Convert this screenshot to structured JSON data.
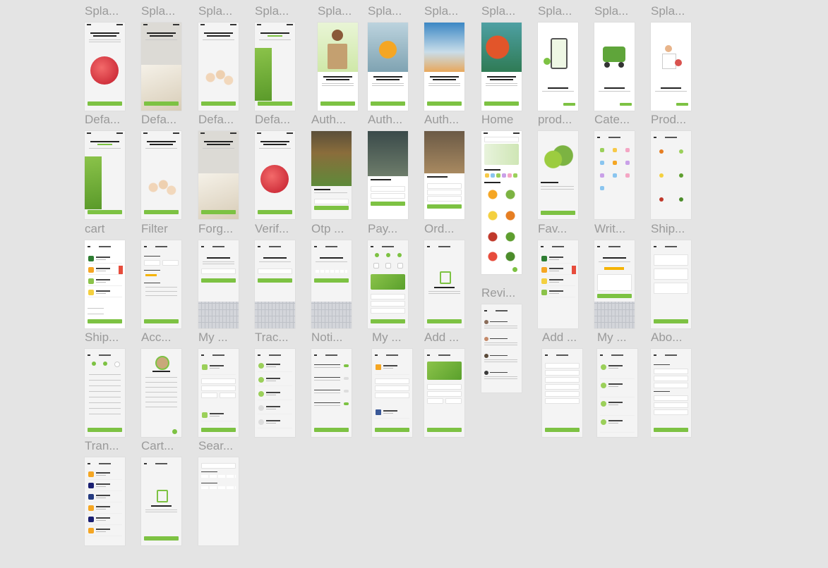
{
  "canvas": {
    "background": "#e4e4e4",
    "accent": "#7dc243"
  },
  "frames": {
    "f01": "Spla...",
    "f02": "Spla...",
    "f03": "Spla...",
    "f04": "Spla...",
    "f05": "Spla...",
    "f06": "Spla...",
    "f07": "Spla...",
    "f08": "Spla...",
    "f09": "Spla...",
    "f10": "Spla...",
    "f11": "Spla...",
    "f12": "Defa...",
    "f13": "Defa...",
    "f14": "Defa...",
    "f15": "Defa...",
    "f16": "Auth...",
    "f17": "Auth...",
    "f18": "Auth...",
    "f19": "Home",
    "f20": "prod...",
    "f21": "Cate...",
    "f22": "Prod...",
    "f23": "cart",
    "f24": "Filter",
    "f25": "Forg...",
    "f26": "Verif...",
    "f27": "Otp ...",
    "f28": "Pay...",
    "f29": "Ord...",
    "f30": "Revi...",
    "f31": "Fav...",
    "f32": "Writ...",
    "f33": "Ship...",
    "f34": "Ship...",
    "f35": "Acc...",
    "f36": "My ...",
    "f37": "Trac...",
    "f38": "Noti...",
    "f39": "My ...",
    "f40": "Add ...",
    "f41": "Add ...",
    "f42": "My ...",
    "f43": "Abo...",
    "f44": "Tran...",
    "f45": "Cart...",
    "f46": "Sear..."
  }
}
